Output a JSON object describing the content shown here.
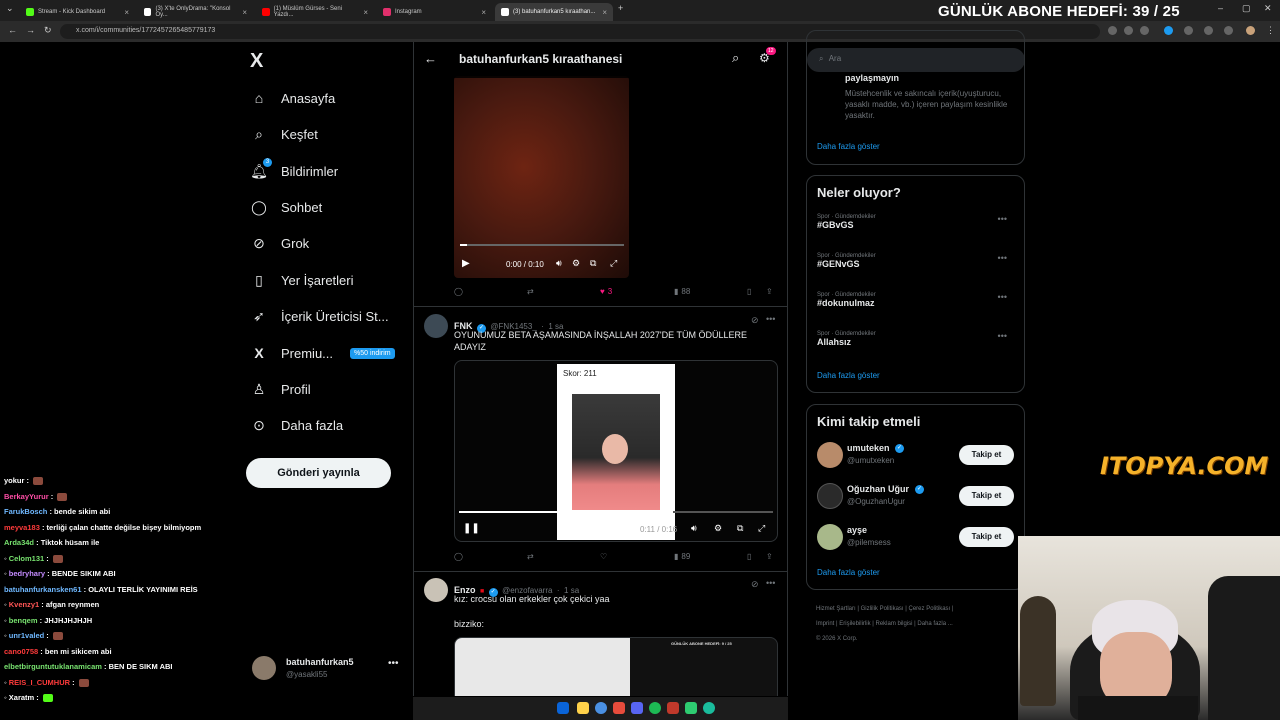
{
  "browser": {
    "tabs": [
      {
        "label": "Stream - Kick Dashboard",
        "color": "#53fc18"
      },
      {
        "label": "(3) X'te OnlyDrama: \"Konsol Oy...",
        "color": "#ffffff"
      },
      {
        "label": "(1) Müslüm Gürses - Seni Yazdı...",
        "color": "#ff0000"
      },
      {
        "label": "Instagram",
        "color": "#e1306c"
      },
      {
        "label": "(3) batuhanfurkan5 kıraathan...",
        "color": "#ffffff"
      }
    ],
    "url": "x.com/i/communities/1772457265485779173",
    "goal_text": "GÜNLÜK ABONE HEDEFİ: 39 / 25"
  },
  "nav": {
    "logo": "X",
    "items": [
      {
        "label": "Anasayfa",
        "icon": "home-icon"
      },
      {
        "label": "Keşfet",
        "icon": "search-icon"
      },
      {
        "label": "Bildirimler",
        "icon": "bell-icon",
        "badge": "3"
      },
      {
        "label": "Sohbet",
        "icon": "chat-icon"
      },
      {
        "label": "Grok",
        "icon": "grok-icon"
      },
      {
        "label": "Yer İşaretleri",
        "icon": "bookmark-icon"
      },
      {
        "label": "İçerik Üreticisi St...",
        "icon": "rocket-icon"
      },
      {
        "label": "Premiu...",
        "icon": "x-logo-icon",
        "promo": "%50 indirim"
      },
      {
        "label": "Profil",
        "icon": "person-icon"
      },
      {
        "label": "Daha fazla",
        "icon": "more-circle-icon"
      }
    ],
    "post_button": "Gönderi yayınla",
    "account": {
      "name": "batuhanfurkan5",
      "handle": "@yasakli55"
    }
  },
  "center": {
    "title": "batuhanfurkan5 kıraathanesi",
    "settings_badge": "12",
    "video1": {
      "time": "0:00 / 0:10",
      "likes": "3",
      "views": "88"
    },
    "tweet2": {
      "name": "FNK",
      "handle": "@FNK1453_",
      "time": "1 sa",
      "text": "OYUNUMUZ BETA AŞAMASINDA İNŞALLAH 2027'DE TÜM ÖDÜLLERE ADAYIZ",
      "score": "Skor: 211",
      "time_display": "0:11 / 0:16",
      "views": "89"
    },
    "tweet3": {
      "name": "Enzo",
      "handle": "@enzofavarra",
      "time": "1 sa",
      "text": "kız: crocsu olan erkekler çok çekici yaa",
      "text2": "bizziko:",
      "mini_goal": "GÜNLÜK ABONE HEDEFİ: 9 / 25"
    }
  },
  "right": {
    "search_placeholder": "Ara",
    "rules": {
      "title_tail": "paylaşmayın",
      "body": "Müstehcenlik ve sakıncalı içerik(uyuşturucu, yasaklı madde, vb.) içeren paylaşım kesinlikle yasaktır.",
      "more": "Daha fazla göster"
    },
    "trends": {
      "title": "Neler oluyor?",
      "items": [
        {
          "cat": "Spor · Gündemdekiler",
          "name": "#GBvGS"
        },
        {
          "cat": "Spor · Gündemdekiler",
          "name": "#GENvGS"
        },
        {
          "cat": "Spor · Gündemdekiler",
          "name": "#dokunulmaz"
        },
        {
          "cat": "Spor · Gündemdekiler",
          "name": "Allahsız"
        }
      ],
      "more": "Daha fazla göster"
    },
    "follow": {
      "title": "Kimi takip etmeli",
      "users": [
        {
          "name": "umuteken",
          "handle": "@umutxeken",
          "button": "Takip et"
        },
        {
          "name": "Oğuzhan Uğur",
          "handle": "@OguzhanUgur",
          "button": "Takip et"
        },
        {
          "name": "ayşe",
          "handle": "@pilemsess",
          "button": "Takip et"
        }
      ],
      "more": "Daha fazla göster"
    },
    "footer": [
      "Hizmet Şartları",
      "Gizlilik Politikası",
      "Çerez Politikası",
      "Imprint",
      "Erişilebilirlik",
      "Reklam bilgisi",
      "Daha fazla ...",
      "© 2026 X Corp."
    ]
  },
  "chat": [
    {
      "user": "yokur",
      "msg": "",
      "color": "#ffffff",
      "emote": true
    },
    {
      "user": "BerkayYurur",
      "msg": "",
      "color": "#ff4da6",
      "emote": true
    },
    {
      "user": "FarukBosch",
      "msg": "bende sikim abi",
      "color": "#6fb8ff"
    },
    {
      "user": "meyva183",
      "msg": "terliği çalan chatte değilse bişey bilmiyopm",
      "color": "#ff3b3b"
    },
    {
      "user": "Arda34d",
      "msg": "Tiktok hüsam ile",
      "color": "#78e26f"
    },
    {
      "user": "Celom131",
      "msg": "",
      "color": "#78e26f",
      "emote": true
    },
    {
      "user": "bedryhary",
      "msg": "BENDE SIKIM ABI",
      "color": "#c48bff"
    },
    {
      "user": "batuhanfurkansken61",
      "msg": "OLAYLI TERLİK YAYINIMI REİS",
      "color": "#6fb8ff"
    },
    {
      "user": "Kvenzy1",
      "msg": "afgan reynmen",
      "color": "#ff5555"
    },
    {
      "user": "benqem",
      "msg": "JHJHJHJHJH",
      "color": "#78e26f"
    },
    {
      "user": "unr1valed",
      "msg": "",
      "color": "#6fb8ff",
      "emote": true
    },
    {
      "user": "cano0758",
      "msg": "ben mi sikicem abi",
      "color": "#ff3b3b"
    },
    {
      "user": "elbetbirguntutuklanamicam",
      "msg": "BEN DE SIKM ABI",
      "color": "#78e26f"
    },
    {
      "user": "REIS_I_CUMHUR",
      "msg": "",
      "color": "#ff3b3b",
      "emote": true
    },
    {
      "user": "Xaratm",
      "msg": "",
      "color": "#ffffff",
      "emote": true
    }
  ],
  "overlay_logo": "ITOPYA.COM"
}
